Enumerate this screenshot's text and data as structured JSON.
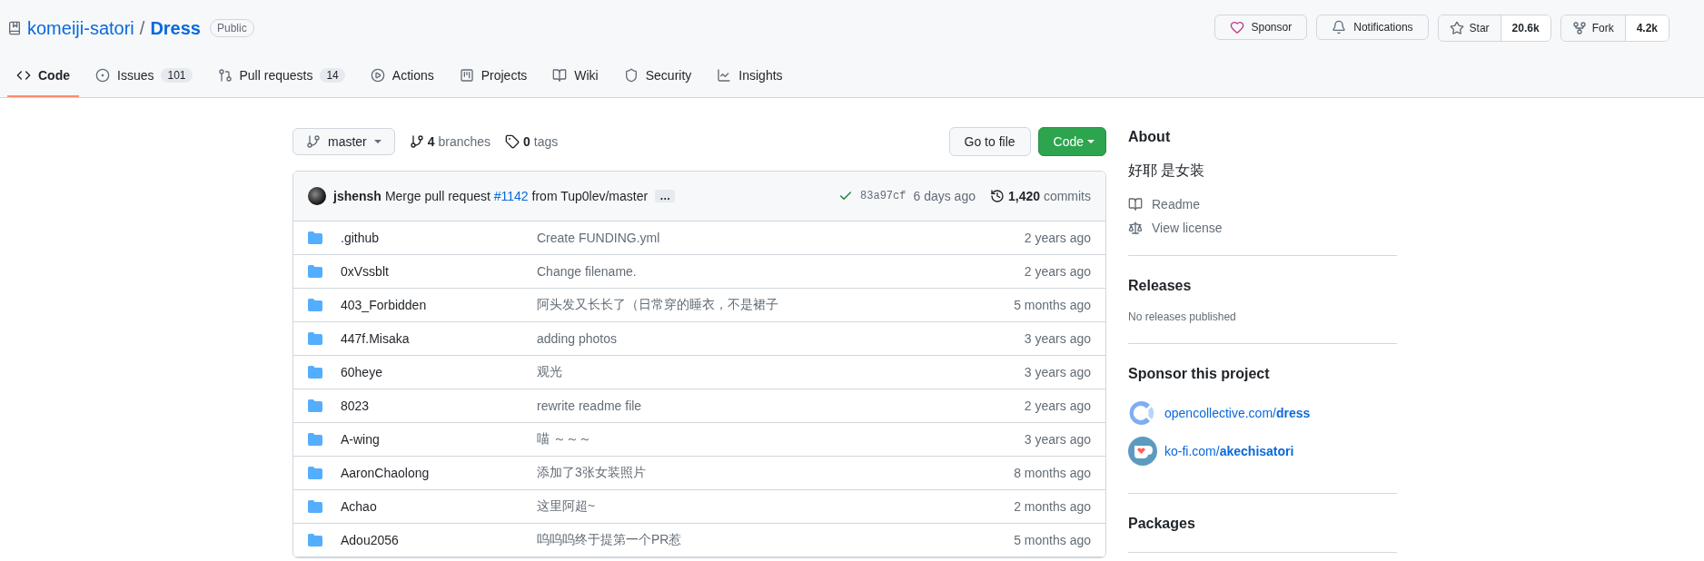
{
  "repo": {
    "owner": "komeiji-satori",
    "separator": "/",
    "name": "Dress",
    "visibility": "Public"
  },
  "header_actions": {
    "sponsor": "Sponsor",
    "notifications": "Notifications",
    "star": {
      "label": "Star",
      "count": "20.6k"
    },
    "fork": {
      "label": "Fork",
      "count": "4.2k"
    }
  },
  "tabs": [
    {
      "kind": "code",
      "label": "Code",
      "selected": true
    },
    {
      "kind": "issues",
      "label": "Issues",
      "counter": "101",
      "selected": false
    },
    {
      "kind": "pulls",
      "label": "Pull requests",
      "counter": "14",
      "selected": false
    },
    {
      "kind": "actions",
      "label": "Actions",
      "selected": false
    },
    {
      "kind": "projects",
      "label": "Projects",
      "selected": false
    },
    {
      "kind": "wiki",
      "label": "Wiki",
      "selected": false
    },
    {
      "kind": "security",
      "label": "Security",
      "selected": false
    },
    {
      "kind": "insights",
      "label": "Insights",
      "selected": false
    }
  ],
  "toolbar": {
    "branch": "master",
    "branches": "**4** branches",
    "tags": "**0** tags",
    "go_to_file": "Go to file",
    "code_button": "Code"
  },
  "commit": {
    "author": "jshensh",
    "message_before": "Merge pull request",
    "pr": "#1142",
    "message_after": "from Tup0lev/master",
    "more": "…",
    "sha": "83a97cf",
    "time": "6 days ago",
    "commits": "**1,420** commits"
  },
  "files": [
    {
      "name": ".github",
      "message": "Create FUNDING.yml",
      "time": "2 years ago"
    },
    {
      "name": "0xVssblt",
      "message": "Change filename.",
      "time": "2 years ago"
    },
    {
      "name": "403_Forbidden",
      "message": "阿头发又长长了（日常穿的睡衣，不是裙子",
      "time": "5 months ago"
    },
    {
      "name": "447f.Misaka",
      "message": "adding photos",
      "time": "3 years ago"
    },
    {
      "name": "60heye",
      "message": "观光",
      "time": "3 years ago"
    },
    {
      "name": "8023",
      "message": "rewrite readme file",
      "time": "2 years ago"
    },
    {
      "name": "A-wing",
      "message": "喵 ～～～",
      "time": "3 years ago"
    },
    {
      "name": "AaronChaolong",
      "message": "添加了3张女装照片",
      "time": "8 months ago"
    },
    {
      "name": "Achao",
      "message": "这里阿超~",
      "time": "2 months ago"
    },
    {
      "name": "Adou2056",
      "message": "呜呜呜终于提第一个PR惹",
      "time": "5 months ago"
    }
  ],
  "about": {
    "title": "About",
    "description": "好耶 是女装",
    "links": [
      {
        "kind": "readme",
        "label": "Readme"
      },
      {
        "kind": "license",
        "label": "View license"
      }
    ]
  },
  "releases": {
    "title": "Releases",
    "text": "No releases published"
  },
  "sponsor": {
    "title": "Sponsor this project",
    "links": [
      {
        "kind": "opencollective",
        "label": "opencollective.com/**dress**"
      },
      {
        "kind": "kofi",
        "label": "ko-fi.com/**akechisatori**"
      }
    ]
  },
  "packages": {
    "title": "Packages"
  }
}
